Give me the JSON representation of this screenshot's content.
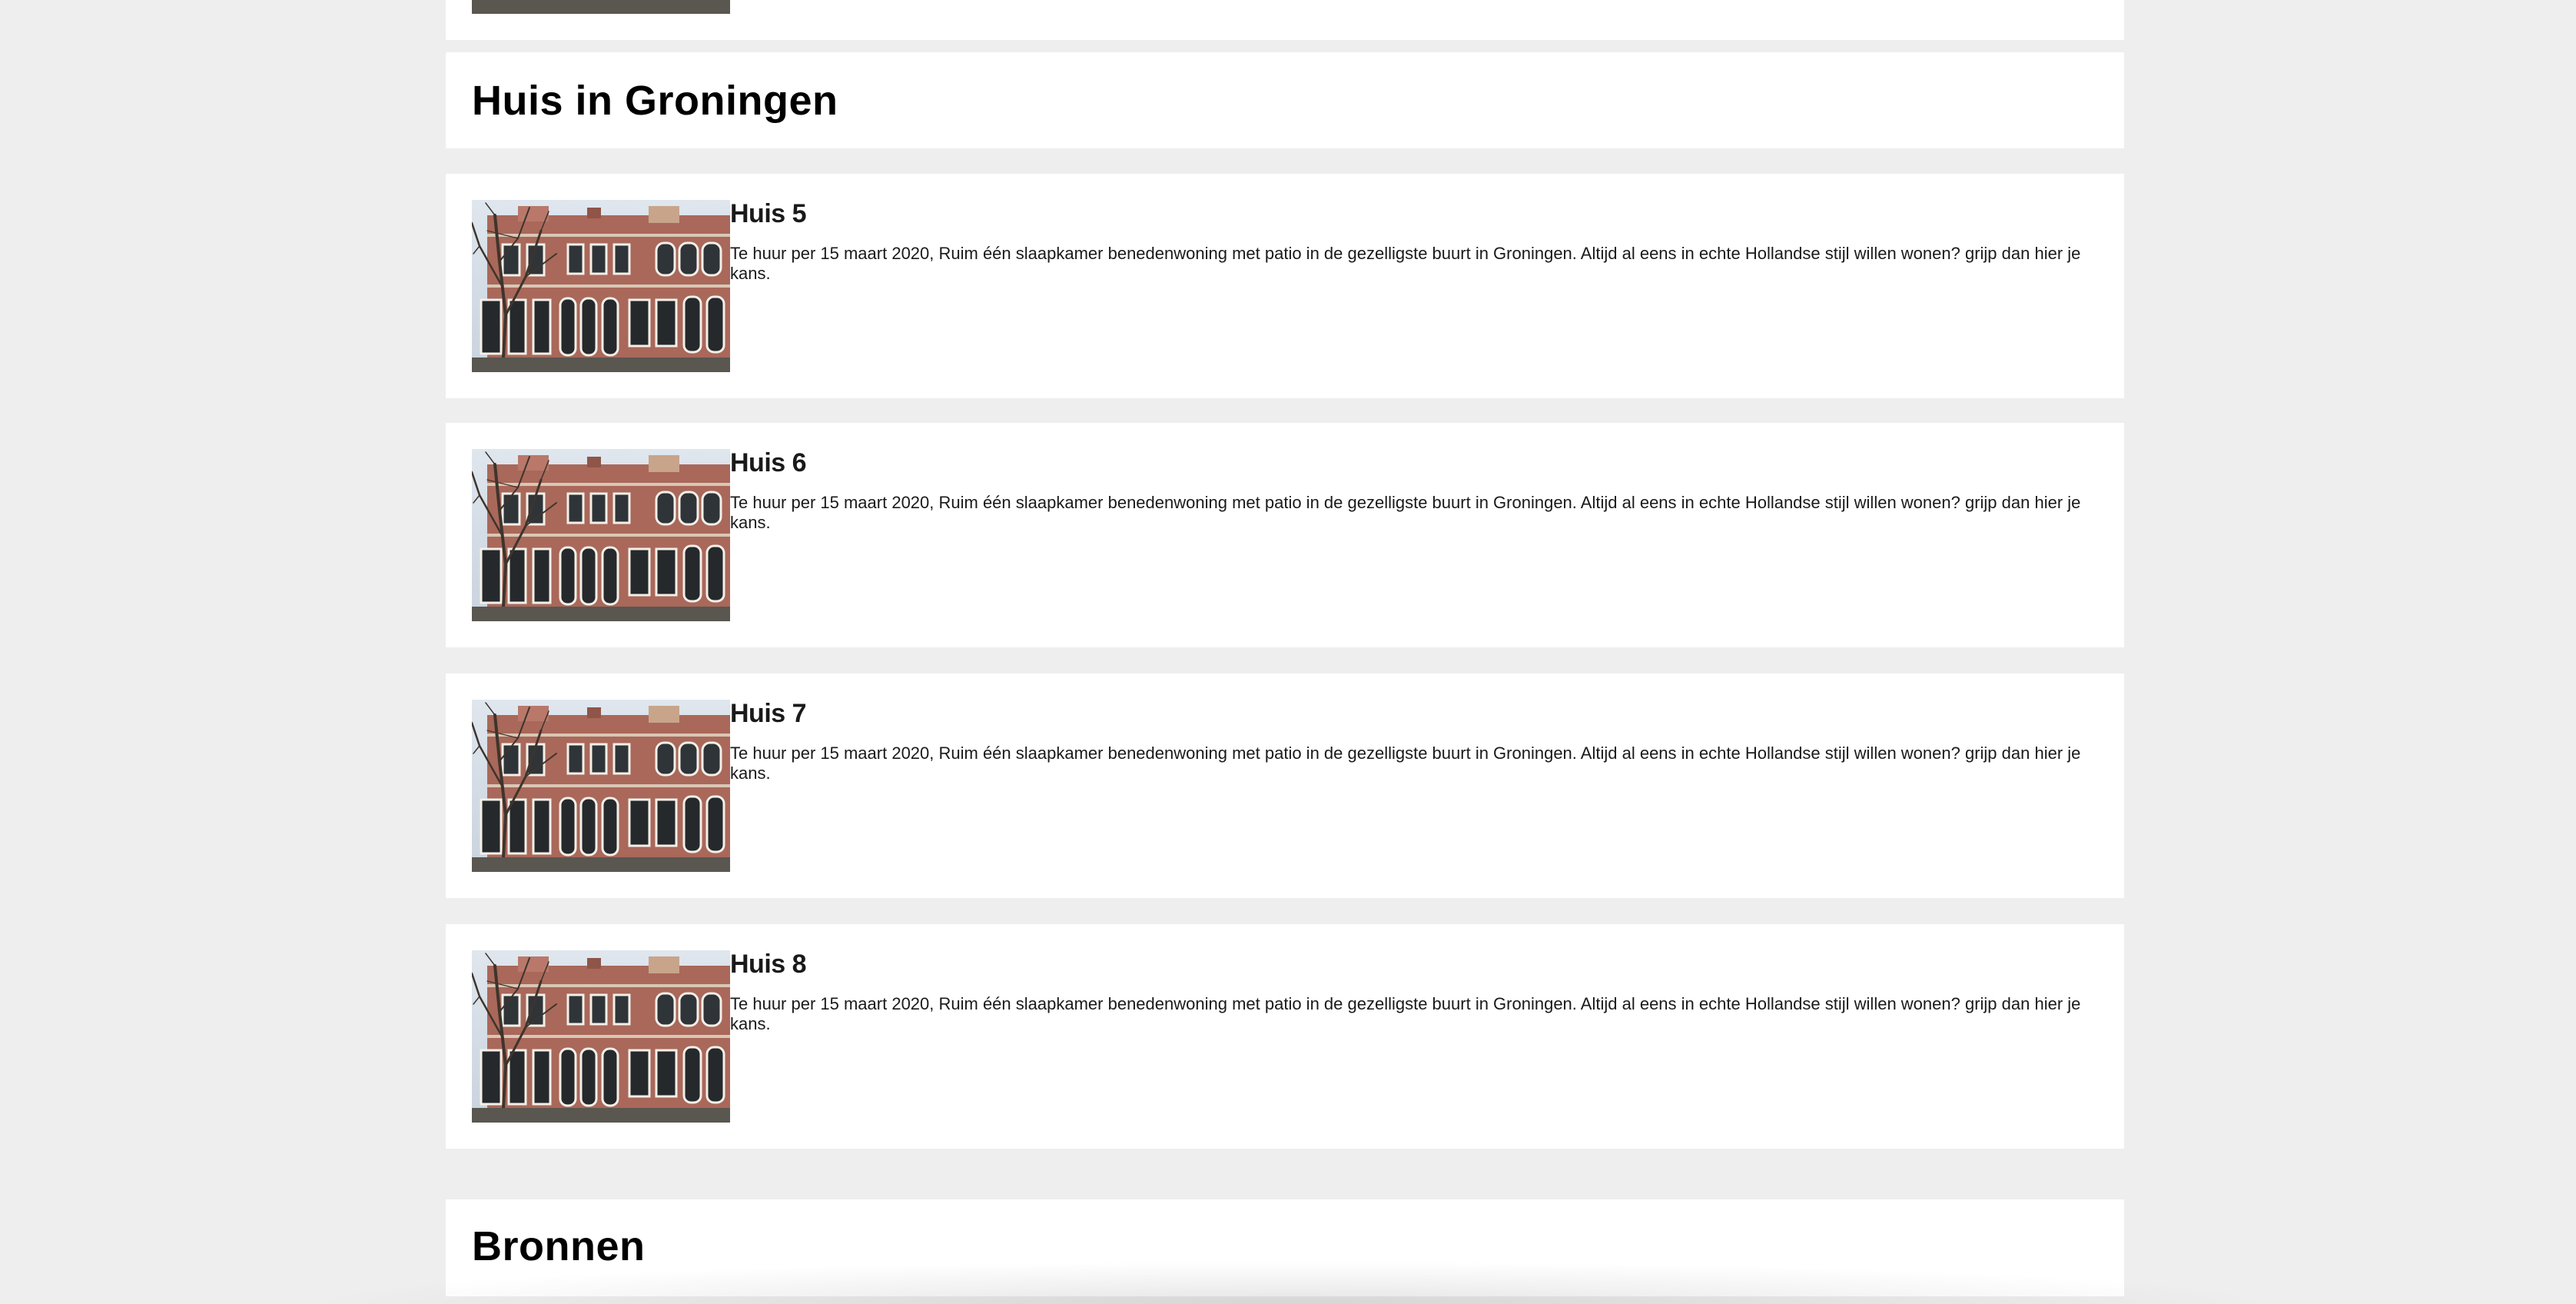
{
  "sections": {
    "groningen_title": "Huis in Groningen",
    "sources_title": "Bronnen"
  },
  "listings": [
    {
      "title": "Huis 5",
      "description": "Te huur per 15 maart 2020, Ruim één slaapkamer benedenwoning met patio in de gezelligste buurt in Groningen. Altijd al eens in echte Hollandse stijl willen wonen? grijp dan hier je kans."
    },
    {
      "title": "Huis 6",
      "description": "Te huur per 15 maart 2020, Ruim één slaapkamer benedenwoning met patio in de gezelligste buurt in Groningen. Altijd al eens in echte Hollandse stijl willen wonen? grijp dan hier je kans."
    },
    {
      "title": "Huis 7",
      "description": "Te huur per 15 maart 2020, Ruim één slaapkamer benedenwoning met patio in de gezelligste buurt in Groningen. Altijd al eens in echte Hollandse stijl willen wonen? grijp dan hier je kans."
    },
    {
      "title": "Huis 8",
      "description": "Te huur per 15 maart 2020, Ruim één slaapkamer benedenwoning met patio in de gezelligste buurt in Groningen. Altijd al eens in echte Hollandse stijl willen wonen? grijp dan hier je kans."
    }
  ],
  "colors": {
    "page_background": "#eeeeee",
    "card_background": "#ffffff",
    "text": "#1a1a1a"
  },
  "icons": {
    "listing_photo": "house-photo"
  }
}
